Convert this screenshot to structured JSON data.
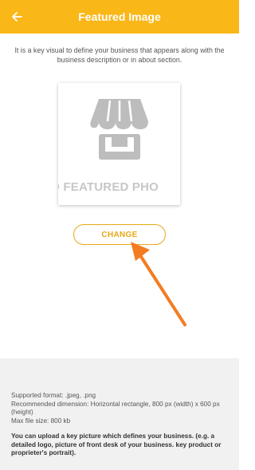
{
  "appbar": {
    "title": "Featured Image",
    "back_icon": "arrow-left-icon",
    "color": "#f9b718"
  },
  "intro_text": "It is a key visual to define your business that appears along with the business description or in about section.",
  "photo": {
    "icon": "store-icon",
    "placeholder_text": "D FEATURED PHO"
  },
  "change_button": {
    "label": "CHANGE",
    "color": "#e6a816"
  },
  "annotation": {
    "icon": "pointer-arrow-icon",
    "color": "#f47c20"
  },
  "footer": {
    "supported_format": "Supported format: .jpeg, .png",
    "recommended_dimension": "Recommended dimension: Horizontal rectangle, 800 px (width) x 600 px (height)",
    "max_file_size": "Max file size: 800 kb",
    "note": "You can upload a key picture which defines your business. (e.g. a detailed logo, picture of front desk of your business. key product or proprieter's portrait)."
  }
}
